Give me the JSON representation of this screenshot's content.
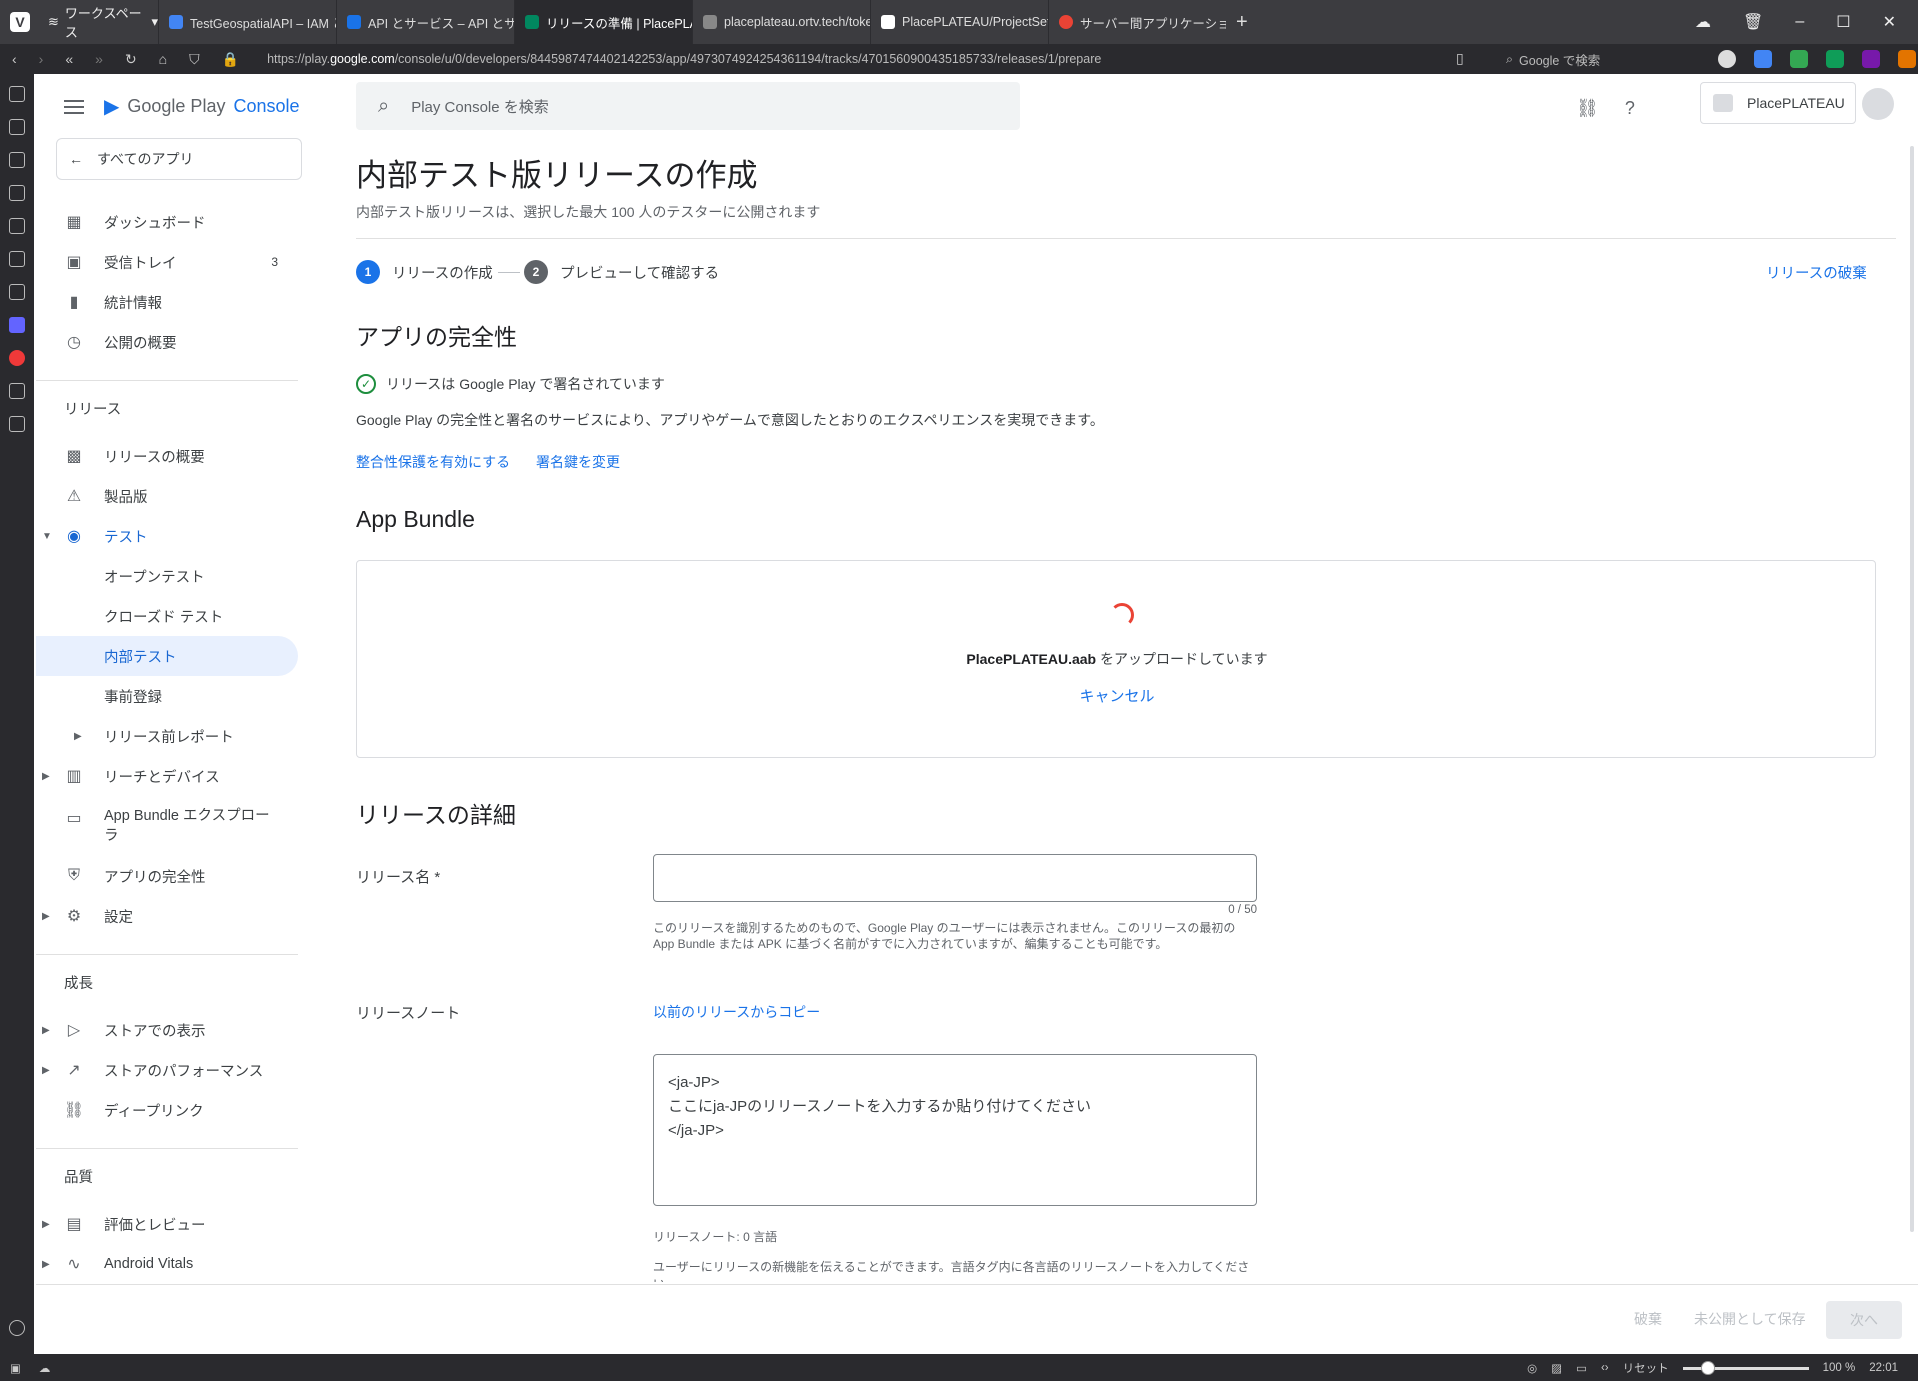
{
  "browser": {
    "workspace_label": "ワークスペース",
    "tabs": [
      {
        "title": "TestGeospatialAPI – IAM と管理",
        "color": "#4285f4"
      },
      {
        "title": "API とサービス – API とサービス",
        "color": "#1a73e8"
      },
      {
        "title": "リリースの準備 | PlacePLATEAU",
        "color": "#01875f"
      },
      {
        "title": "placeplateau.ortv.tech/token",
        "color": "#888888"
      },
      {
        "title": "PlacePLATEAU/ProjectSettings",
        "color": "#ffffff"
      },
      {
        "title": "サーバー間アプリケーションに OAuth",
        "color": "#ea4335"
      }
    ],
    "url_prefix": "https://play.",
    "url_domain": "google.com",
    "url_path": "/console/u/0/developers/8445987474402142253/app/4973074924254361194/tracks/4701560900435185733/releases/1/prepare",
    "search_placeholder": "Google で検索",
    "status": {
      "reset": "リセット",
      "zoom": "100 %",
      "time": "22:01"
    }
  },
  "console": {
    "brand_google": "Google Play",
    "brand_console": "Console",
    "all_apps": "すべてのアプリ",
    "search_placeholder": "Play Console を検索",
    "developer": "PlacePLATEAU"
  },
  "nav": {
    "dashboard": "ダッシュボード",
    "inbox": "受信トレイ",
    "inbox_count": "3",
    "stats": "統計情報",
    "publishing": "公開の概要",
    "release_section": "リリース",
    "release_overview": "リリースの概要",
    "production": "製品版",
    "testing": "テスト",
    "open_test": "オープンテスト",
    "closed_test": "クローズド テスト",
    "internal_test": "内部テスト",
    "pre_registration": "事前登録",
    "pre_launch_report": "リリース前レポート",
    "reach_devices": "リーチとデバイス",
    "bundle_explorer": "App Bundle エクスプローラ",
    "app_integrity": "アプリの完全性",
    "settings": "設定",
    "growth_section": "成長",
    "store_presence": "ストアでの表示",
    "store_performance": "ストアのパフォーマンス",
    "deep_links": "ディープリンク",
    "quality_section": "品質",
    "ratings_reviews": "評価とレビュー",
    "android_vitals": "Android Vitals"
  },
  "main": {
    "title": "内部テスト版リリースの作成",
    "subtitle": "内部テスト版リリースは、選択した最大 100 人のテスターに公開されます",
    "step1_num": "1",
    "step1": "リリースの作成",
    "step2_num": "2",
    "step2": "プレビューして確認する",
    "discard_release": "リリースの破棄",
    "integrity_heading": "アプリの完全性",
    "signed_text": "リリースは Google Play で署名されています",
    "integrity_desc": "Google Play の完全性と署名のサービスにより、アプリやゲームで意図したとおりのエクスペリエンスを実現できます。",
    "enable_integrity": "整合性保護を有効にする",
    "change_key": "署名鍵を変更",
    "bundle_heading": "App Bundle",
    "upload_file": "PlacePLATEAU.aab",
    "upload_text": " をアップロードしています",
    "cancel": "キャンセル",
    "details_heading": "リリースの詳細",
    "release_name_label": "リリース名 *",
    "release_name_value": "",
    "release_name_counter": "0 / 50",
    "release_name_hint": "このリリースを識別するためのもので、Google Play のユーザーには表示されません。このリリースの最初の App Bundle または APK に基づく名前がすでに入力されていますが、編集することも可能です。",
    "notes_label": "リリースノート",
    "copy_previous": "以前のリリースからコピー",
    "notes_value": "<ja-JP>\nここにja-JPのリリースノートを入力するか貼り付けてください\n</ja-JP>",
    "notes_lang": "リリースノート: 0 言語",
    "notes_hint": "ユーザーにリリースの新機能を伝えることができます。言語タグ内に各言語のリリースノートを入力してください。"
  },
  "footer": {
    "discard": "破棄",
    "save_draft": "未公開として保存",
    "next": "次へ"
  }
}
